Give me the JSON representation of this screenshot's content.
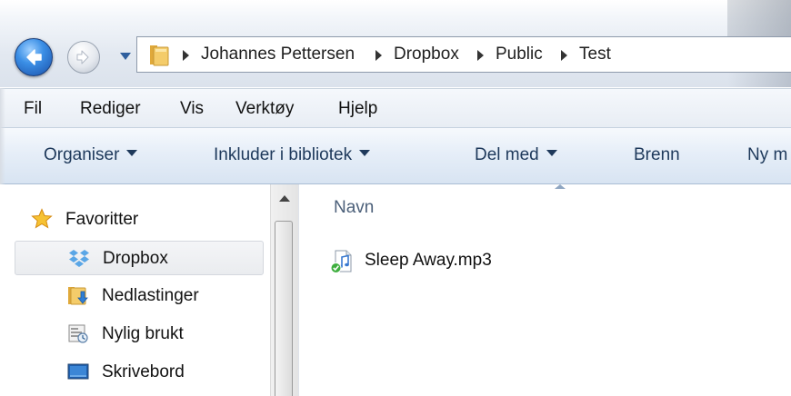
{
  "address_bar": {
    "breadcrumbs": [
      "Johannes Pettersen",
      "Dropbox",
      "Public",
      "Test"
    ]
  },
  "menu_bar": {
    "items": [
      "Fil",
      "Rediger",
      "Vis",
      "Verktøy",
      "Hjelp"
    ]
  },
  "toolbar": {
    "buttons": [
      {
        "label": "Organiser",
        "has_dropdown": true
      },
      {
        "label": "Inkluder i bibliotek",
        "has_dropdown": true
      },
      {
        "label": "Del med",
        "has_dropdown": true
      },
      {
        "label": "Brenn",
        "has_dropdown": false
      },
      {
        "label": "Ny m",
        "has_dropdown": false
      }
    ]
  },
  "nav_pane": {
    "items": [
      {
        "label": "Favoritter",
        "icon": "star-icon"
      },
      {
        "label": "Dropbox",
        "icon": "dropbox-icon",
        "selected": true
      },
      {
        "label": "Nedlastinger",
        "icon": "downloads-folder-icon"
      },
      {
        "label": "Nylig brukt",
        "icon": "recent-places-icon"
      },
      {
        "label": "Skrivebord",
        "icon": "desktop-icon"
      }
    ]
  },
  "file_list": {
    "column_header": "Navn",
    "files": [
      {
        "name": "Sleep Away.mp3",
        "icon": "audio-file-synced-icon"
      }
    ]
  },
  "colors": {
    "toolbar_text": "#1e395b",
    "column_header_text": "#4c607a",
    "selection_background": "#eaecef"
  }
}
